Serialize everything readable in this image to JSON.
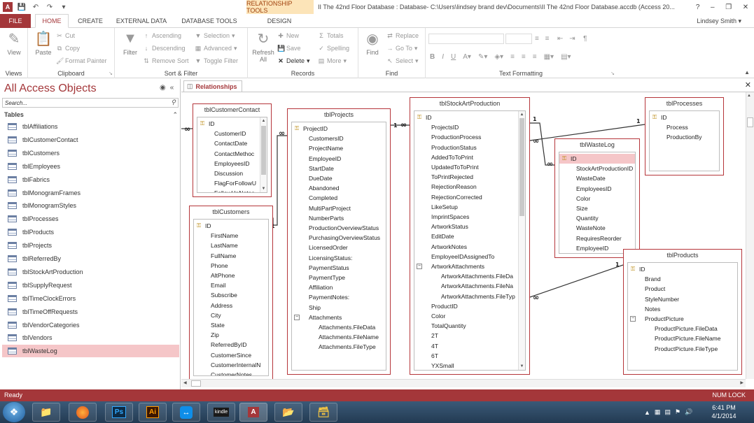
{
  "titlebar": {
    "context_group": "RELATIONSHIP TOOLS",
    "window_title": "II The 42nd Floor Database : Database- C:\\Users\\lindsey brand dev\\Documents\\II The 42nd Floor Database.accdb (Access 20...",
    "help": "?",
    "minimize": "–",
    "restore": "❐",
    "close": "✕"
  },
  "tabs": [
    "FILE",
    "HOME",
    "CREATE",
    "EXTERNAL DATA",
    "DATABASE TOOLS",
    "DESIGN"
  ],
  "user": "Lindsey Smith",
  "ribbon": {
    "views": {
      "label": "Views",
      "view": "View"
    },
    "clipboard": {
      "label": "Clipboard",
      "paste": "Paste",
      "cut": "Cut",
      "copy": "Copy",
      "format_painter": "Format Painter"
    },
    "sort_filter": {
      "label": "Sort & Filter",
      "filter": "Filter",
      "ascending": "Ascending",
      "descending": "Descending",
      "remove_sort": "Remove Sort",
      "selection": "Selection",
      "advanced": "Advanced",
      "toggle_filter": "Toggle Filter"
    },
    "records": {
      "label": "Records",
      "refresh_all": "Refresh All",
      "new": "New",
      "save": "Save",
      "delete": "Delete",
      "totals": "Totals",
      "spelling": "Spelling",
      "more": "More"
    },
    "find": {
      "label": "Find",
      "find": "Find",
      "replace": "Replace",
      "goto": "Go To",
      "select": "Select"
    },
    "text_formatting": {
      "label": "Text Formatting",
      "bold": "B",
      "italic": "I",
      "underline": "U"
    }
  },
  "nav": {
    "title": "All Access Objects",
    "search_placeholder": "Search...",
    "section": "Tables",
    "items": [
      "tblAffiliations",
      "tblCustomerContact",
      "tblCustomers",
      "tblEmployees",
      "tblFabrics",
      "tblMonogramFrames",
      "tblMonogramStyles",
      "tblProcesses",
      "tblProducts",
      "tblProjects",
      "tblReferredBy",
      "tblStockArtProduction",
      "tblSupplyRequest",
      "tblTimeClockErrors",
      "tblTimeOffRequests",
      "tblVendorCategories",
      "tblVendors",
      "tblWasteLog"
    ],
    "selected": "tblWasteLog"
  },
  "doc": {
    "tab_label": "Relationships"
  },
  "tables": {
    "customerContact": {
      "title": "tblCustomerContact",
      "fields": [
        "ID",
        "CustomerID",
        "ContactDate",
        "ContactMethoc",
        "EmployeesID",
        "Discussion",
        "FlagForFollowU",
        "FollowUpNotes"
      ]
    },
    "customers": {
      "title": "tblCustomers",
      "fields": [
        "ID",
        "FirstName",
        "LastName",
        "FullName",
        "Phone",
        "AltPhone",
        "Email",
        "Subscribe",
        "Address",
        "City",
        "State",
        "Zip",
        "ReferredByID",
        "CustomerSince",
        "CustomerInternalN",
        "CustomerNotes"
      ]
    },
    "projects": {
      "title": "tblProjects",
      "fields": [
        "ProjectID",
        "CustomersID",
        "ProjectName",
        "EmployeeID",
        "StartDate",
        "DueDate",
        "Abandoned",
        "Completed",
        "MultiPartProject",
        "NumberParts",
        "ProductionOverviewStatus",
        "PurchasingOverviewStatus",
        "LicensedOrder",
        "LicensingStatus:",
        "PaymentStatus",
        "PaymentType",
        "Affiliation",
        "PaymentNotes:",
        "Ship",
        "Attachments",
        "Attachments.FileData",
        "Attachments.FileName",
        "Attachments.FileType"
      ]
    },
    "stockArt": {
      "title": "tblStockArtProduction",
      "fields": [
        "ID",
        "ProjectsID",
        "ProductionProcess",
        "ProductionStatus",
        "AddedToToPrint",
        "UpdatedToToPrint",
        "ToPrintRejected",
        "RejectionReason",
        "RejectionCorrected",
        "LikeSetup",
        "ImprintSpaces",
        "ArtworkStatus",
        "EditDate",
        "ArtworkNotes",
        "EmployeeIDAssignedTo",
        "ArtworkAttachments",
        "ArtworkAttachments.FileDa",
        "ArtworkAttachments.FileNa",
        "ArtworkAttachments.FileTyp",
        "ProductID",
        "Color",
        "TotalQuantity",
        "2T",
        "4T",
        "6T",
        "YXSmall"
      ]
    },
    "processes": {
      "title": "tblProcesses",
      "fields": [
        "ID",
        "Process",
        "ProductionBy"
      ]
    },
    "wasteLog": {
      "title": "tblWasteLog",
      "fields": [
        "ID",
        "StockArtProductionID",
        "WasteDate",
        "EmployeesID",
        "Color",
        "Size",
        "Quantity",
        "WasteNote",
        "RequiresReorder",
        "EmployeeID"
      ]
    },
    "products": {
      "title": "tblProducts",
      "fields": [
        "ID",
        "Brand",
        "Product",
        "StyleNumber",
        "Notes",
        "ProductPicture",
        "ProductPicture.FileData",
        "ProductPicture.FileName",
        "ProductPicture.FileType"
      ]
    }
  },
  "relationship_labels": {
    "one": "1",
    "many": "∞"
  },
  "status": {
    "left": "Ready",
    "right": "NUM LOCK"
  },
  "taskbar": {
    "apps": [
      "Ps",
      "Ai",
      "kindle",
      "A"
    ],
    "time": "6:41 PM",
    "date": "4/1/2014"
  },
  "colors": {
    "accent": "#a4373a",
    "selection": "#f5c6c8",
    "context": "#fce4b8"
  }
}
